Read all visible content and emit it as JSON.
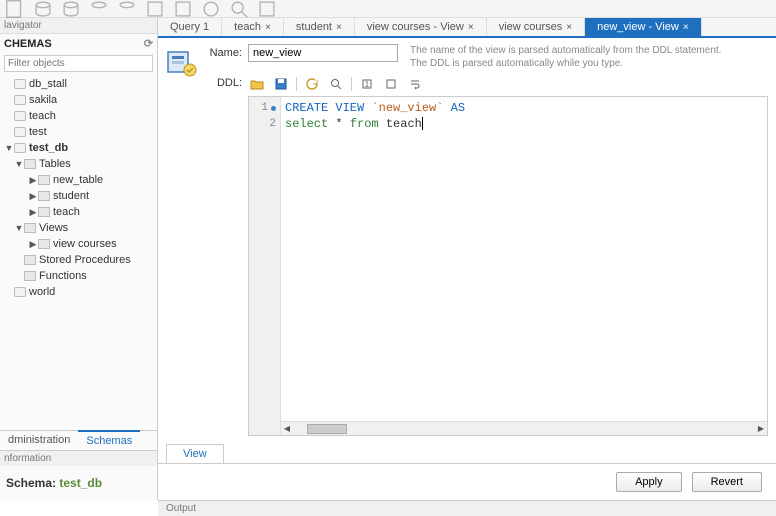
{
  "toolbar_icons": [
    "db-new",
    "db-open",
    "sql-new",
    "sql-open",
    "run",
    "run-script",
    "explain",
    "stop",
    "commit",
    "search",
    "config"
  ],
  "sidebar": {
    "nav_title": "lavigator",
    "schemas_label": "CHEMAS",
    "filter_placeholder": "Filter objects",
    "nodes": [
      {
        "label": "db_stall",
        "lvl": 0,
        "bold": false,
        "arrow": "",
        "icon": "db"
      },
      {
        "label": "sakila",
        "lvl": 0,
        "bold": false,
        "arrow": "",
        "icon": "db"
      },
      {
        "label": "teach",
        "lvl": 0,
        "bold": false,
        "arrow": "",
        "icon": "db"
      },
      {
        "label": "test",
        "lvl": 0,
        "bold": false,
        "arrow": "",
        "icon": "db"
      },
      {
        "label": "test_db",
        "lvl": 0,
        "bold": true,
        "arrow": "▼",
        "icon": "db"
      },
      {
        "label": "Tables",
        "lvl": 1,
        "bold": false,
        "arrow": "▼",
        "icon": "folder"
      },
      {
        "label": "new_table",
        "lvl": 2,
        "bold": false,
        "arrow": "▶",
        "icon": "tbl"
      },
      {
        "label": "student",
        "lvl": 2,
        "bold": false,
        "arrow": "▶",
        "icon": "tbl"
      },
      {
        "label": "teach",
        "lvl": 2,
        "bold": false,
        "arrow": "▶",
        "icon": "tbl"
      },
      {
        "label": "Views",
        "lvl": 1,
        "bold": false,
        "arrow": "▼",
        "icon": "folder"
      },
      {
        "label": "view courses",
        "lvl": 2,
        "bold": false,
        "arrow": "▶",
        "icon": "tbl"
      },
      {
        "label": "Stored Procedures",
        "lvl": 1,
        "bold": false,
        "arrow": "",
        "icon": "folder"
      },
      {
        "label": "Functions",
        "lvl": 1,
        "bold": false,
        "arrow": "",
        "icon": "folder"
      },
      {
        "label": "world",
        "lvl": 0,
        "bold": false,
        "arrow": "",
        "icon": "db"
      }
    ],
    "tabs": {
      "admin": "dministration",
      "schemas": "Schemas"
    },
    "info_title": "nformation",
    "schema_key": "Schema:",
    "schema_val": "test_db"
  },
  "main": {
    "tabs": [
      {
        "label": "Query 1",
        "active": false,
        "close": false
      },
      {
        "label": "teach",
        "active": false,
        "close": true
      },
      {
        "label": "student",
        "active": false,
        "close": true
      },
      {
        "label": "view courses - View",
        "active": false,
        "close": true
      },
      {
        "label": "view courses",
        "active": false,
        "close": true
      },
      {
        "label": "new_view - View",
        "active": true,
        "close": true
      }
    ],
    "name_label": "Name:",
    "name_value": "new_view",
    "name_hint": "The name of the view is parsed automatically from the DDL statement. The DDL is parsed automatically while you type.",
    "ddl_label": "DDL:",
    "ddl_toolbar": [
      "open-icon",
      "save-icon",
      "revert-icon",
      "find-icon",
      "beautify-icon",
      "toggle-icon",
      "wrap-icon"
    ],
    "sql": {
      "l1": {
        "kw": "CREATE VIEW",
        "name": "`new_view`",
        "as": "AS"
      },
      "l2": {
        "sel": "select",
        "star": "*",
        "from": "from",
        "tbl": "teach"
      }
    },
    "lower_tab": "View",
    "apply": "Apply",
    "revert": "Revert",
    "output": "Output"
  }
}
